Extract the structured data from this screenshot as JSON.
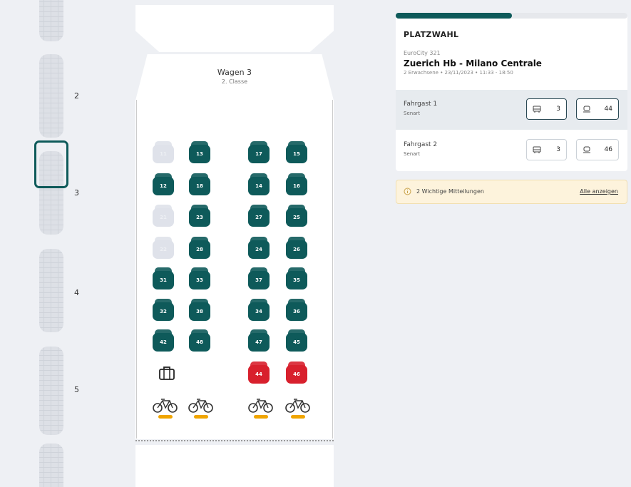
{
  "overview": {
    "wagon_numbers": [
      "2",
      "3",
      "4",
      "5"
    ]
  },
  "wagon": {
    "title": "Wagen 3",
    "class": "2. Classe"
  },
  "seats": [
    {
      "label": "11",
      "state": "taken"
    },
    {
      "label": "13",
      "state": "free"
    },
    {
      "label": "17",
      "state": "free"
    },
    {
      "label": "15",
      "state": "free"
    },
    {
      "label": "12",
      "state": "free"
    },
    {
      "label": "18",
      "state": "free"
    },
    {
      "label": "14",
      "state": "free"
    },
    {
      "label": "16",
      "state": "free"
    },
    {
      "label": "21",
      "state": "taken"
    },
    {
      "label": "23",
      "state": "free"
    },
    {
      "label": "27",
      "state": "free"
    },
    {
      "label": "25",
      "state": "free"
    },
    {
      "label": "22",
      "state": "taken"
    },
    {
      "label": "28",
      "state": "free"
    },
    {
      "label": "24",
      "state": "free"
    },
    {
      "label": "26",
      "state": "free"
    },
    {
      "label": "31",
      "state": "free"
    },
    {
      "label": "33",
      "state": "free"
    },
    {
      "label": "37",
      "state": "free"
    },
    {
      "label": "35",
      "state": "free"
    },
    {
      "label": "32",
      "state": "free"
    },
    {
      "label": "38",
      "state": "free"
    },
    {
      "label": "34",
      "state": "free"
    },
    {
      "label": "36",
      "state": "free"
    },
    {
      "label": "42",
      "state": "free"
    },
    {
      "label": "48",
      "state": "free"
    },
    {
      "label": "47",
      "state": "free"
    },
    {
      "label": "45",
      "state": "free"
    },
    {
      "label": "44",
      "state": "selected"
    },
    {
      "label": "46",
      "state": "selected"
    }
  ],
  "panel": {
    "progress": 0.5,
    "heading": "PLATZWAHL",
    "train": "EuroCity 321",
    "route": "Zuerich Hb - Milano Centrale",
    "meta": "2 Erwachsene • 23/11/2023 • 11:33 - 18:50",
    "passengers": [
      {
        "name": "Fahrgast 1",
        "type": "Senart",
        "wagon": "3",
        "seat": "44"
      },
      {
        "name": "Fahrgast 2",
        "type": "Senart",
        "wagon": "3",
        "seat": "46"
      }
    ]
  },
  "notice": {
    "text": "2 Wichtige Mitteilungen",
    "link": "Alle anzeigen"
  },
  "colors": {
    "accent": "#0e5a5a",
    "selected": "#d8202d",
    "bike": "#f0a500"
  }
}
